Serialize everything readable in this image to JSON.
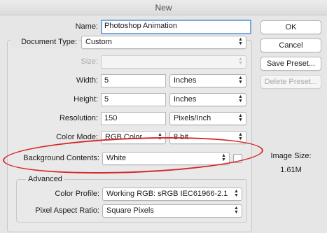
{
  "window": {
    "title": "New"
  },
  "form": {
    "name": {
      "label": "Name:",
      "value": "Photoshop Animation"
    },
    "document_type": {
      "label": "Document Type:",
      "value": "Custom"
    },
    "size": {
      "label": "Size:",
      "value": ""
    },
    "width": {
      "label": "Width:",
      "value": "5",
      "unit": "Inches"
    },
    "height": {
      "label": "Height:",
      "value": "5",
      "unit": "Inches"
    },
    "resolution": {
      "label": "Resolution:",
      "value": "150",
      "unit": "Pixels/Inch"
    },
    "color_mode": {
      "label": "Color Mode:",
      "value": "RGB Color",
      "depth": "8 bit"
    },
    "background_contents": {
      "label": "Background Contents:",
      "value": "White"
    }
  },
  "advanced": {
    "legend": "Advanced",
    "color_profile": {
      "label": "Color Profile:",
      "value": "Working RGB:  sRGB IEC61966-2.1"
    },
    "pixel_aspect_ratio": {
      "label": "Pixel Aspect Ratio:",
      "value": "Square Pixels"
    }
  },
  "buttons": {
    "ok": "OK",
    "cancel": "Cancel",
    "save_preset": "Save Preset...",
    "delete_preset": "Delete Preset..."
  },
  "image_size": {
    "label": "Image Size:",
    "value": "1.61M"
  },
  "annotation": {
    "color": "#d42a2a"
  },
  "icons": {
    "dropdown": "updown-arrows-icon"
  }
}
